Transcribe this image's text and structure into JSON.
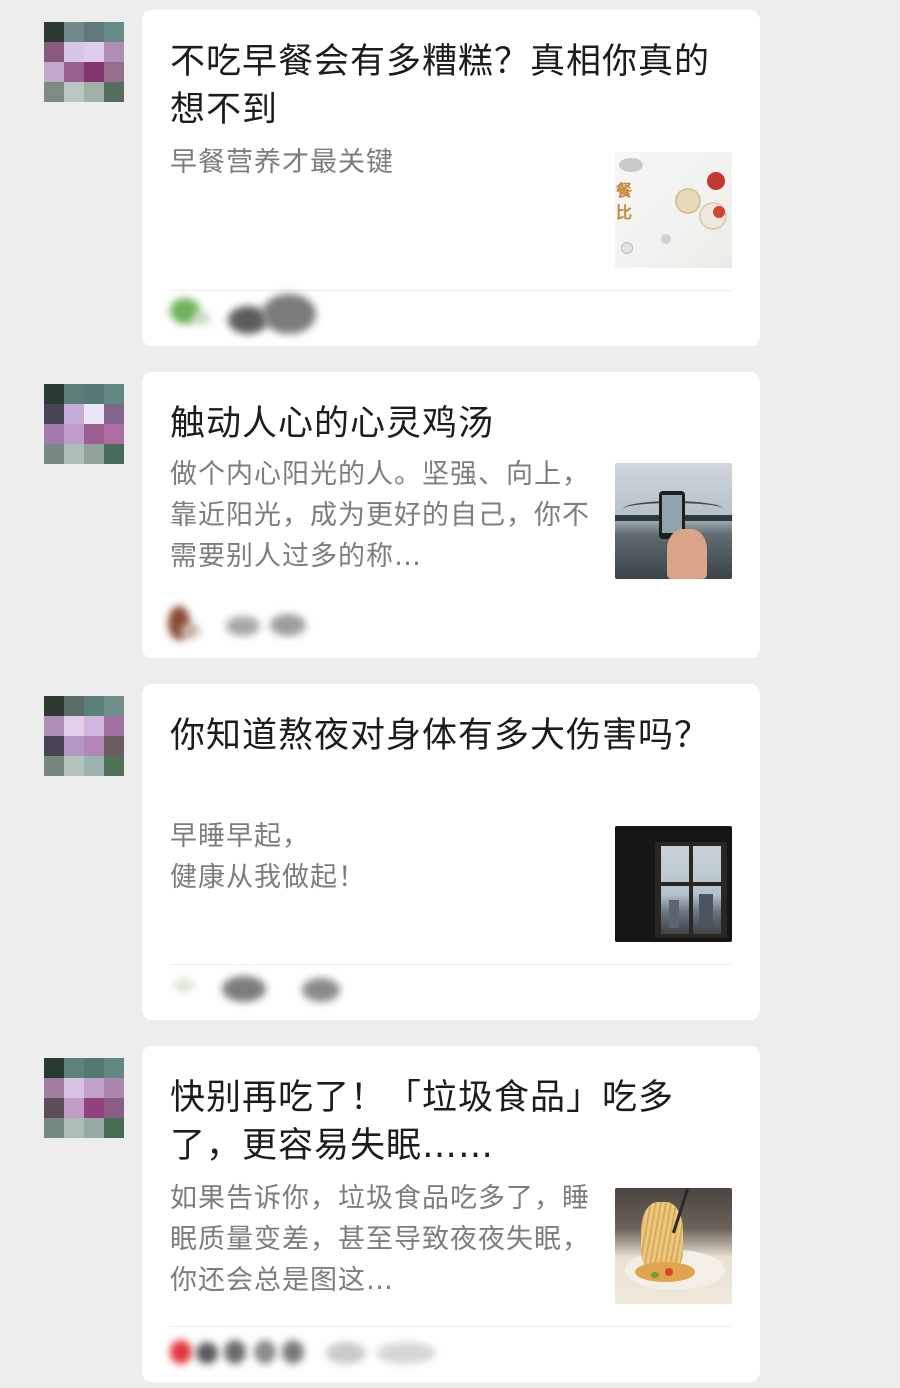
{
  "posts": [
    {
      "title": "不吃早餐会有多糟糕？真相你真的想不到",
      "summary": "早餐营养才最关键",
      "thumbnail": "breakfast-foods-photo",
      "thumb_text": "餐\n比"
    },
    {
      "title": "触动人心的心灵鸡汤",
      "summary": "做个内心阳光的人。坚强、向上，靠近阳光，成为更好的自己，你不需要别人过多的称…",
      "thumbnail": "hand-holding-phone-bridge-photo"
    },
    {
      "title": "你知道熬夜对身体有多大伤害吗？",
      "summary": "早睡早起，\n健康从我做起！",
      "thumbnail": "dark-window-night-photo"
    },
    {
      "title": "快别再吃了！「垃圾食品」吃多了，更容易失眠……",
      "summary": "如果告诉你，垃圾食品吃多了，睡眠质量变差，甚至导致夜夜失眠，你还会总是图这…",
      "thumbnail": "instant-noodles-photo"
    }
  ],
  "colors": {
    "background": "#ededed",
    "card": "#ffffff",
    "title": "#1c1c1c",
    "summary": "#7d7d7d"
  }
}
